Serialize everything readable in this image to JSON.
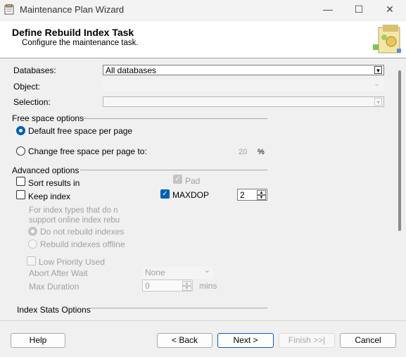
{
  "window": {
    "title": "Maintenance Plan Wizard",
    "minimize": "—",
    "maximize": "☐",
    "close": "✕"
  },
  "header": {
    "title": "Define Rebuild Index Task",
    "subtitle": "Configure the maintenance task."
  },
  "form": {
    "databases_label": "Databases:",
    "databases_value": "All databases",
    "object_label": "Object:",
    "object_value": "",
    "selection_label": "Selection:",
    "selection_value": ""
  },
  "free_space": {
    "group": "Free space options",
    "default_label": "Default free space per page",
    "change_label": "Change free space per page to:",
    "change_value": "20",
    "percent": "%",
    "selected": "default"
  },
  "advanced": {
    "group": "Advanced options",
    "sort_results": "Sort results in",
    "keep_index": "Keep index",
    "pad": "Pad",
    "maxdop": "MAXDOP",
    "maxdop_value": "2",
    "online_text_1": "For index types that do n",
    "online_text_2": "support online index rebu",
    "do_not_rebuild": "Do not rebuild indexes",
    "rebuild_offline": "Rebuild indexes offline",
    "low_priority": "Low Priority Used",
    "abort_after_wait": "Abort After Wait",
    "abort_value": "None",
    "max_duration": "Max Duration",
    "max_duration_value": "0",
    "mins": "mins"
  },
  "index_stats": {
    "group": "Index Stats Options"
  },
  "buttons": {
    "help": "Help",
    "back": "< Back",
    "next": "Next >",
    "finish": "Finish >>|",
    "cancel": "Cancel"
  }
}
